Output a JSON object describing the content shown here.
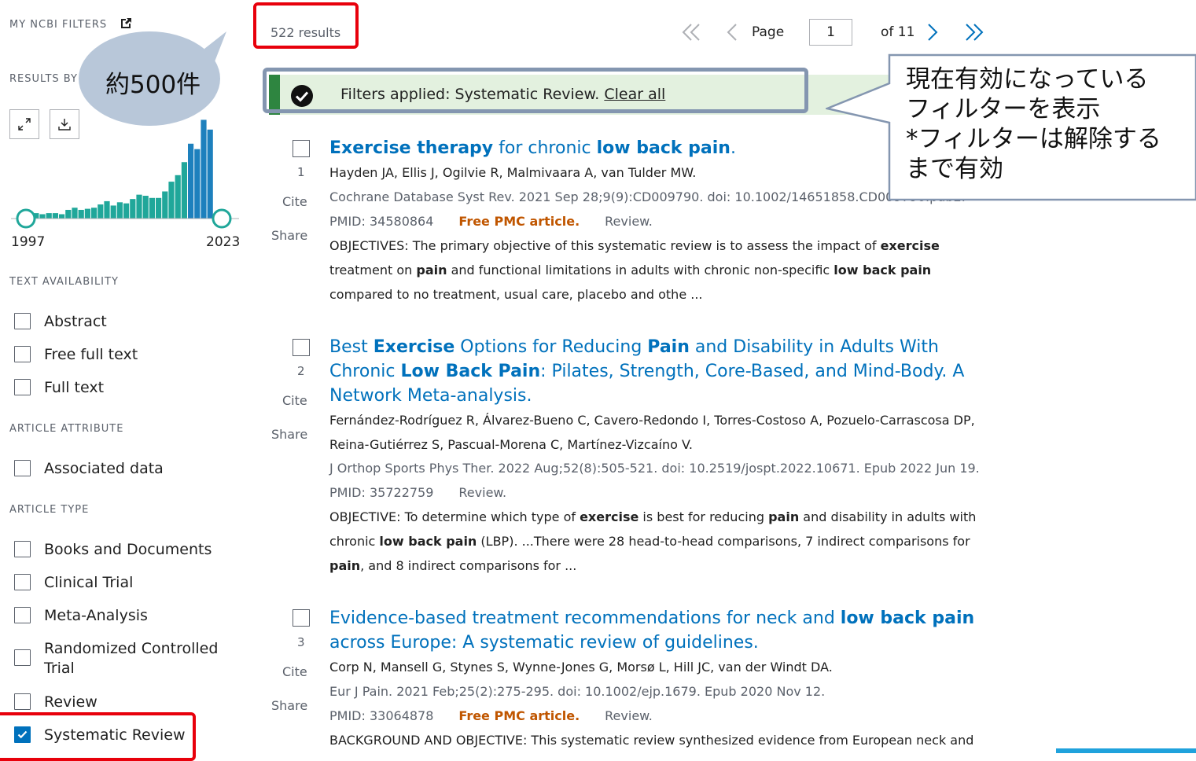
{
  "sidebar": {
    "my_ncbi_filters": "MY NCBI FILTERS",
    "results_by_year": "RESULTS BY",
    "year_start": "1997",
    "year_end": "2023",
    "timeline_bars": [
      0.04,
      0.05,
      0.04,
      0.05,
      0.05,
      0.04,
      0.08,
      0.1,
      0.08,
      0.09,
      0.1,
      0.13,
      0.16,
      0.12,
      0.15,
      0.14,
      0.18,
      0.22,
      0.21,
      0.19,
      0.19,
      0.25,
      0.34,
      0.4,
      0.52,
      0.69,
      0.64,
      0.91,
      0.82,
      0.04
    ],
    "sections": {
      "text_availability": {
        "heading": "TEXT AVAILABILITY",
        "items": [
          {
            "label": "Abstract",
            "checked": false
          },
          {
            "label": "Free full text",
            "checked": false
          },
          {
            "label": "Full text",
            "checked": false
          }
        ]
      },
      "article_attribute": {
        "heading": "ARTICLE ATTRIBUTE",
        "items": [
          {
            "label": "Associated data",
            "checked": false
          }
        ]
      },
      "article_type": {
        "heading": "ARTICLE TYPE",
        "items": [
          {
            "label": "Books and Documents",
            "checked": false
          },
          {
            "label": "Clinical Trial",
            "checked": false
          },
          {
            "label": "Meta-Analysis",
            "checked": false
          },
          {
            "label": "Randomized Controlled",
            "label2": "Trial",
            "checked": false
          },
          {
            "label": "Review",
            "checked": false
          },
          {
            "label": "Systematic Review",
            "checked": true
          }
        ]
      }
    }
  },
  "header": {
    "results_count": "522 results",
    "page_label": "Page",
    "page_value": "1",
    "page_of": "of 11"
  },
  "banner": {
    "text": "Filters applied: Systematic Review.",
    "clear_all": "Clear all"
  },
  "results": [
    {
      "number": "1",
      "cite": "Cite",
      "share": "Share",
      "title_parts": [
        {
          "t": "Exercise therapy",
          "b": true
        },
        {
          "t": " for chronic ",
          "b": false
        },
        {
          "t": "low back pain",
          "b": true
        },
        {
          "t": ".",
          "b": false
        }
      ],
      "authors": "Hayden JA, Ellis J, Ogilvie R, Malmivaara A, van Tulder MW.",
      "citation": "Cochrane Database Syst Rev. 2021 Sep 28;9(9):CD009790. doi: 10.1002/14651858.CD009790.pub2.",
      "pmid": "PMID: 34580864",
      "free": "Free PMC article.",
      "type": "Review.",
      "snippet_parts": [
        {
          "t": "OBJECTIVES: The primary objective of this systematic review is to assess the impact of ",
          "b": false
        },
        {
          "t": "exercise",
          "b": true
        },
        {
          "t": " treatment on ",
          "b": false
        },
        {
          "t": "pain",
          "b": true
        },
        {
          "t": " and functional limitations in adults with chronic non-specific ",
          "b": false
        },
        {
          "t": "low back pain",
          "b": true
        },
        {
          "t": " compared to no treatment, usual care, placebo and othe ...",
          "b": false
        }
      ]
    },
    {
      "number": "2",
      "cite": "Cite",
      "share": "Share",
      "title_parts": [
        {
          "t": "Best ",
          "b": false
        },
        {
          "t": "Exercise",
          "b": true
        },
        {
          "t": " Options for Reducing ",
          "b": false
        },
        {
          "t": "Pain",
          "b": true
        },
        {
          "t": " and Disability in Adults With Chronic ",
          "b": false
        },
        {
          "t": "Low Back Pain",
          "b": true
        },
        {
          "t": ": Pilates, Strength, Core-Based, and Mind-Body. A Network Meta-analysis.",
          "b": false
        }
      ],
      "authors": "Fernández-Rodríguez R, Álvarez-Bueno C, Cavero-Redondo I, Torres-Costoso A, Pozuelo-Carrascosa DP, Reina-Gutiérrez S, Pascual-Morena C, Martínez-Vizcaíno V.",
      "citation": "J Orthop Sports Phys Ther. 2022 Aug;52(8):505-521. doi: 10.2519/jospt.2022.10671. Epub 2022 Jun 19.",
      "pmid": "PMID: 35722759",
      "free": "",
      "type": "Review.",
      "snippet_parts": [
        {
          "t": "OBJECTIVE: To determine which type of ",
          "b": false
        },
        {
          "t": "exercise",
          "b": true
        },
        {
          "t": " is best for reducing ",
          "b": false
        },
        {
          "t": "pain",
          "b": true
        },
        {
          "t": " and disability in adults with chronic ",
          "b": false
        },
        {
          "t": "low back pain",
          "b": true
        },
        {
          "t": " (LBP). ...There were 28 head-to-head comparisons, 7 indirect comparisons for ",
          "b": false
        },
        {
          "t": "pain",
          "b": true
        },
        {
          "t": ", and 8 indirect comparisons for ...",
          "b": false
        }
      ]
    },
    {
      "number": "3",
      "cite": "Cite",
      "share": "Share",
      "title_parts": [
        {
          "t": "Evidence-based treatment recommendations for neck and ",
          "b": false
        },
        {
          "t": "low back pain",
          "b": true
        },
        {
          "t": " across Europe: A systematic review of guidelines.",
          "b": false
        }
      ],
      "authors": "Corp N, Mansell G, Stynes S, Wynne-Jones G, Morsø L, Hill JC, van der Windt DA.",
      "citation": "Eur J Pain. 2021 Feb;25(2):275-295. doi: 10.1002/ejp.1679. Epub 2020 Nov 12.",
      "pmid": "PMID: 33064878",
      "free": "Free PMC article.",
      "type": "Review.",
      "snippet_parts": [
        {
          "t": "BACKGROUND AND OBJECTIVE: This systematic review synthesized evidence from European neck and",
          "b": false
        }
      ]
    }
  ],
  "annotations": {
    "bubble": "約500件",
    "callout_lines": [
      "現在有効になっている",
      "フィルターを表示",
      "*フィルターは解除する",
      "まで有効"
    ]
  },
  "colors": {
    "link": "#0071bc",
    "free_article": "#c05600",
    "banner_bg": "#e3f1df",
    "banner_bar": "#2e8540",
    "annotation_red": "#e8000b",
    "timeline_teal": "#20a79a",
    "timeline_blue": "#1d80bd"
  }
}
